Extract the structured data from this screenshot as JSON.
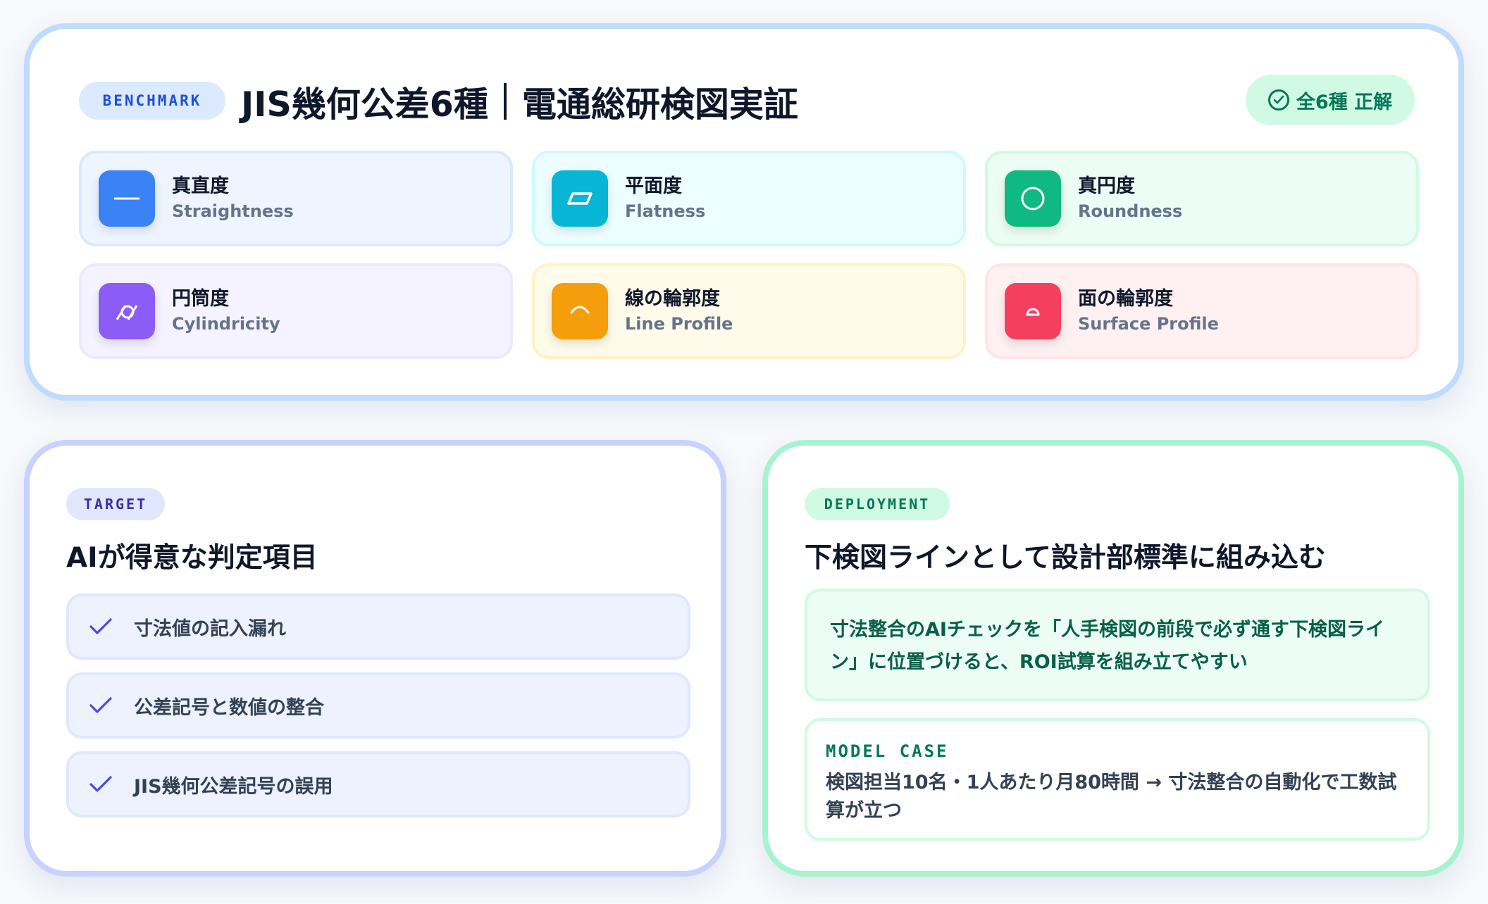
{
  "benchmark": {
    "pill": "BENCHMARK",
    "title_left": "JIS幾何公差6種",
    "title_right": "電通総研検図実証",
    "status": "全6種 正解",
    "items": [
      {
        "jp": "真直度",
        "en": "Straightness",
        "icon": "straightness-icon",
        "color": "#3b82f6"
      },
      {
        "jp": "平面度",
        "en": "Flatness",
        "icon": "flatness-icon",
        "color": "#06b6d4"
      },
      {
        "jp": "真円度",
        "en": "Roundness",
        "icon": "roundness-icon",
        "color": "#10b981"
      },
      {
        "jp": "円筒度",
        "en": "Cylindricity",
        "icon": "cylindricity-icon",
        "color": "#8b5cf6"
      },
      {
        "jp": "線の輪郭度",
        "en": "Line Profile",
        "icon": "line-profile-icon",
        "color": "#f59e0b"
      },
      {
        "jp": "面の輪郭度",
        "en": "Surface Profile",
        "icon": "surface-profile-icon",
        "color": "#f43f5e"
      }
    ]
  },
  "target": {
    "pill": "TARGET",
    "title": "AIが得意な判定項目",
    "items": [
      "寸法値の記入漏れ",
      "公差記号と数値の整合",
      "JIS幾何公差記号の誤用"
    ]
  },
  "deployment": {
    "pill": "DEPLOYMENT",
    "title": "下検図ラインとして設計部標準に組み込む",
    "quote_line1": "寸法整合のAIチェックを「人手検図の前段で必ず通す下検図ライ",
    "quote_line2": "ン」に位置づけると、ROI試算を組み立てやすい",
    "model_case_label": "MODEL CASE",
    "model_case_line1": "検図担当10名・1人あたり月80時間 → 寸法整合の自動化で工数試",
    "model_case_line2": "算が立つ"
  }
}
